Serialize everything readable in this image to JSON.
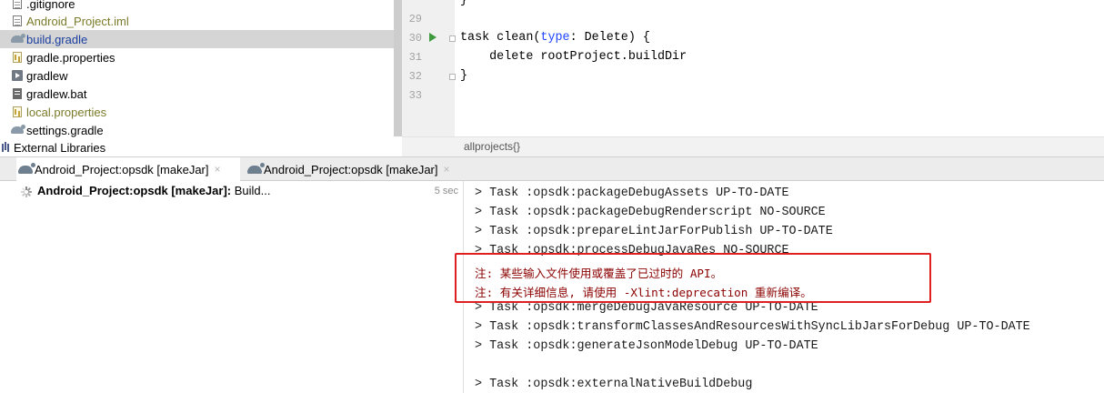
{
  "project_tree": {
    "items": [
      {
        "label": ".gitignore",
        "icon": "file-icon",
        "style": "normal"
      },
      {
        "label": "Android_Project.iml",
        "icon": "file-icon",
        "style": "vcs-ignored"
      },
      {
        "label": "build.gradle",
        "icon": "gradle-elephant-icon",
        "style": "link-blue",
        "selected": true
      },
      {
        "label": "gradle.properties",
        "icon": "properties-file-icon",
        "style": "normal"
      },
      {
        "label": "gradlew",
        "icon": "executable-file-icon",
        "style": "normal"
      },
      {
        "label": "gradlew.bat",
        "icon": "bat-file-icon",
        "style": "normal"
      },
      {
        "label": "local.properties",
        "icon": "properties-file-icon",
        "style": "vcs-ignored"
      },
      {
        "label": "settings.gradle",
        "icon": "gradle-elephant-icon",
        "style": "normal"
      },
      {
        "label": "External Libraries",
        "icon": "libraries-icon",
        "style": "normal"
      }
    ]
  },
  "editor": {
    "line_numbers": [
      "29",
      "30",
      "31",
      "32",
      "33"
    ],
    "line_0": "}",
    "line_30_pre": "task clean(",
    "line_30_param": "type",
    "line_30_post": ": Delete) {",
    "line_31": "    delete rootProject.buildDir",
    "line_32": "}",
    "breadcrumb": "allprojects{}"
  },
  "build_window": {
    "tabs": [
      {
        "label": "Android_Project:opsdk [makeJar]",
        "active": true
      },
      {
        "label": "Android_Project:opsdk [makeJar]",
        "active": false
      }
    ],
    "close_glyph": "×",
    "tree": {
      "task_bold": "Android_Project:opsdk [makeJar]:",
      "status": " Build...",
      "elapsed": "5 sec"
    }
  },
  "console": {
    "lines": [
      "> Task :opsdk:packageDebugAssets UP-TO-DATE",
      "> Task :opsdk:packageDebugRenderscript NO-SOURCE",
      "> Task :opsdk:prepareLintJarForPublish UP-TO-DATE",
      "> Task :opsdk:processDebugJavaRes NO-SOURCE",
      "注: 某些输入文件使用或覆盖了已过时的 API。",
      "注: 有关详细信息, 请使用 -Xlint:deprecation 重新编译。",
      "> Task :opsdk:mergeDebugJavaResource UP-TO-DATE",
      "> Task :opsdk:transformClassesAndResourcesWithSyncLibJarsForDebug UP-TO-DATE",
      "> Task :opsdk:generateJsonModelDebug UP-TO-DATE",
      "",
      "> Task :opsdk:externalNativeBuildDebug"
    ],
    "highlight_color": "#e02020",
    "warning_color": "#8b0000"
  }
}
